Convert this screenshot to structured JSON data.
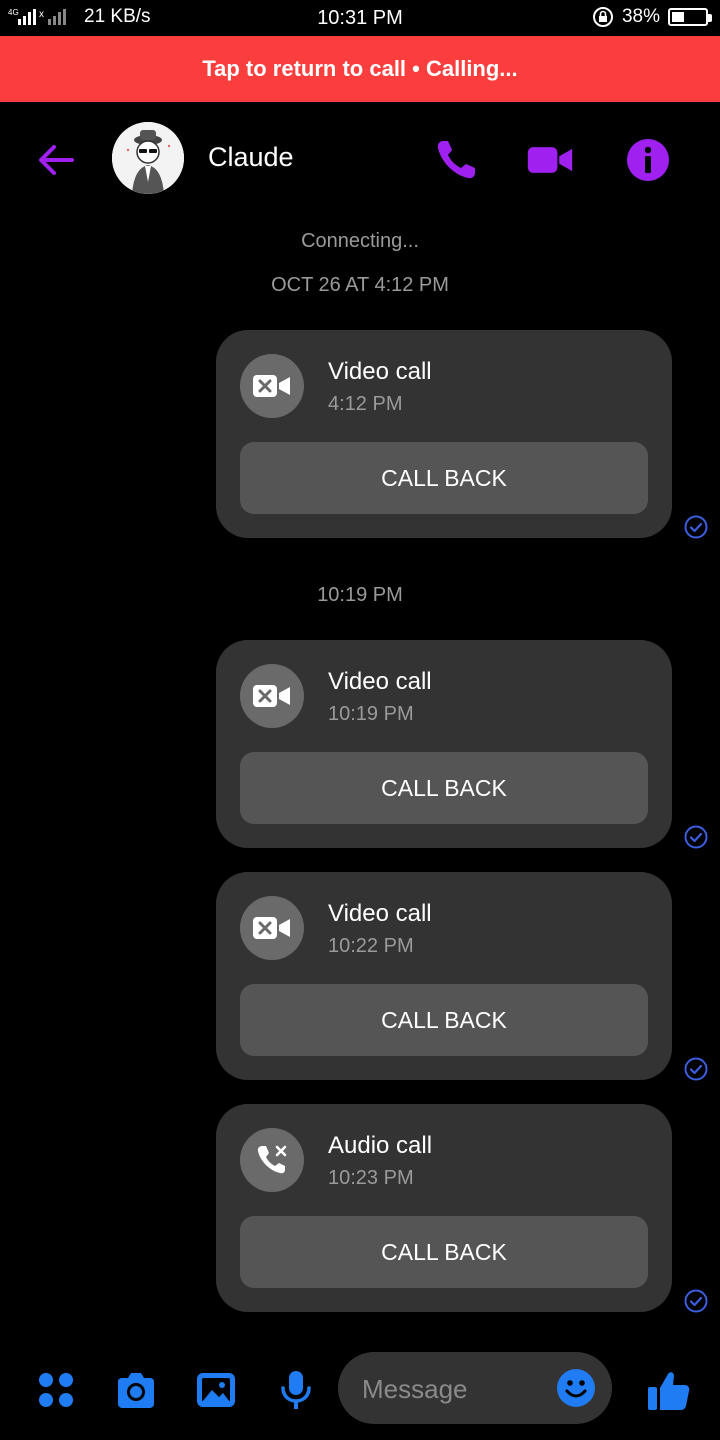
{
  "status_bar": {
    "network_speed": "21 KB/s",
    "time": "10:31 PM",
    "battery": "38%",
    "battery_level": 0.38
  },
  "call_banner": {
    "text": "Tap to return to call • Calling..."
  },
  "header": {
    "contact_name": "Claude",
    "accent_color": "#a020f0"
  },
  "conversation": {
    "status_text": "Connecting...",
    "timestamps": [
      "OCT 26 AT 4:12 PM",
      "10:19 PM"
    ],
    "calls": [
      {
        "type": "Video call",
        "time": "4:12 PM",
        "action": "CALL BACK",
        "icon": "missed-video-icon"
      },
      {
        "type": "Video call",
        "time": "10:19 PM",
        "action": "CALL BACK",
        "icon": "missed-video-icon"
      },
      {
        "type": "Video call",
        "time": "10:22 PM",
        "action": "CALL BACK",
        "icon": "missed-video-icon"
      },
      {
        "type": "Audio call",
        "time": "10:23 PM",
        "action": "CALL BACK",
        "icon": "missed-phone-icon"
      }
    ]
  },
  "composer": {
    "placeholder": "Message",
    "icon_color": "#1f7cf3"
  }
}
